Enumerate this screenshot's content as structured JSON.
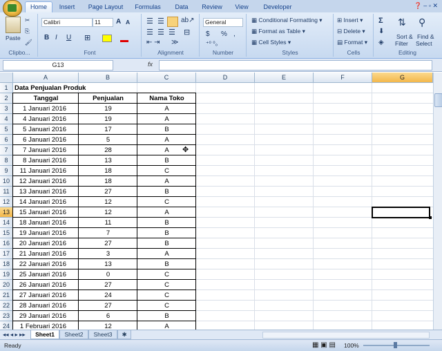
{
  "ribbon": {
    "tabs": [
      "Home",
      "Insert",
      "Page Layout",
      "Formulas",
      "Data",
      "Review",
      "View",
      "Developer"
    ],
    "active_tab": "Home",
    "clipboard": {
      "paste_label": "Paste",
      "group_label": "Clipbo..."
    },
    "font": {
      "name": "Calibri",
      "size": "11",
      "bold": "B",
      "italic": "I",
      "underline": "U",
      "group_label": "Font",
      "grow": "A",
      "shrink": "A"
    },
    "alignment": {
      "group_label": "Alignment"
    },
    "number": {
      "format": "General",
      "currency": "$",
      "percent": "%",
      "comma": ",",
      "group_label": "Number"
    },
    "styles": {
      "conditional": "Conditional Formatting",
      "format_table": "Format as Table",
      "cell_styles": "Cell Styles",
      "group_label": "Styles"
    },
    "cells": {
      "insert": "Insert",
      "delete": "Delete",
      "format": "Format",
      "group_label": "Cells"
    },
    "editing": {
      "sum": "Σ",
      "sort_filter": "Sort &",
      "sort_filter2": "Filter",
      "find_select": "Find &",
      "find_select2": "Select",
      "group_label": "Editing"
    }
  },
  "formula_bar": {
    "name_box": "G13",
    "fx": "fx",
    "formula": ""
  },
  "columns": [
    "A",
    "B",
    "C",
    "D",
    "E",
    "F",
    "G"
  ],
  "selected_column": "G",
  "selected_row": 13,
  "rows": [
    1,
    2,
    3,
    4,
    5,
    6,
    7,
    8,
    9,
    10,
    11,
    12,
    13,
    14,
    15,
    16,
    17,
    18,
    19,
    20,
    21,
    22,
    23,
    24
  ],
  "sheet": {
    "title": "Data Penjualan Produk",
    "headers": [
      "Tanggal",
      "Penjualan",
      "Nama Toko"
    ],
    "data": [
      [
        "1 Januari 2016",
        "19",
        "A"
      ],
      [
        "4 Januari 2016",
        "19",
        "A"
      ],
      [
        "5 Januari 2016",
        "17",
        "B"
      ],
      [
        "6 Januari 2016",
        "5",
        "A"
      ],
      [
        "7 Januari 2016",
        "28",
        "A"
      ],
      [
        "8 Januari 2016",
        "13",
        "B"
      ],
      [
        "11 Januari 2016",
        "18",
        "C"
      ],
      [
        "12 Januari 2016",
        "18",
        "A"
      ],
      [
        "13 Januari 2016",
        "27",
        "B"
      ],
      [
        "14 Januari 2016",
        "12",
        "C"
      ],
      [
        "15 Januari 2016",
        "12",
        "A"
      ],
      [
        "18 Januari 2016",
        "11",
        "B"
      ],
      [
        "19 Januari 2016",
        "7",
        "B"
      ],
      [
        "20 Januari 2016",
        "27",
        "B"
      ],
      [
        "21 Januari 2016",
        "3",
        "A"
      ],
      [
        "22 Januari 2016",
        "13",
        "B"
      ],
      [
        "25 Januari 2016",
        "0",
        "C"
      ],
      [
        "26 Januari 2016",
        "27",
        "C"
      ],
      [
        "27 Januari 2016",
        "24",
        "C"
      ],
      [
        "28 Januari 2016",
        "27",
        "C"
      ],
      [
        "29 Januari 2016",
        "6",
        "B"
      ],
      [
        "1 Februari 2016",
        "12",
        "A"
      ]
    ]
  },
  "sheet_tabs": [
    "Sheet1",
    "Sheet2",
    "Sheet3"
  ],
  "active_sheet": "Sheet1",
  "status": {
    "ready": "Ready",
    "zoom": "100%"
  }
}
